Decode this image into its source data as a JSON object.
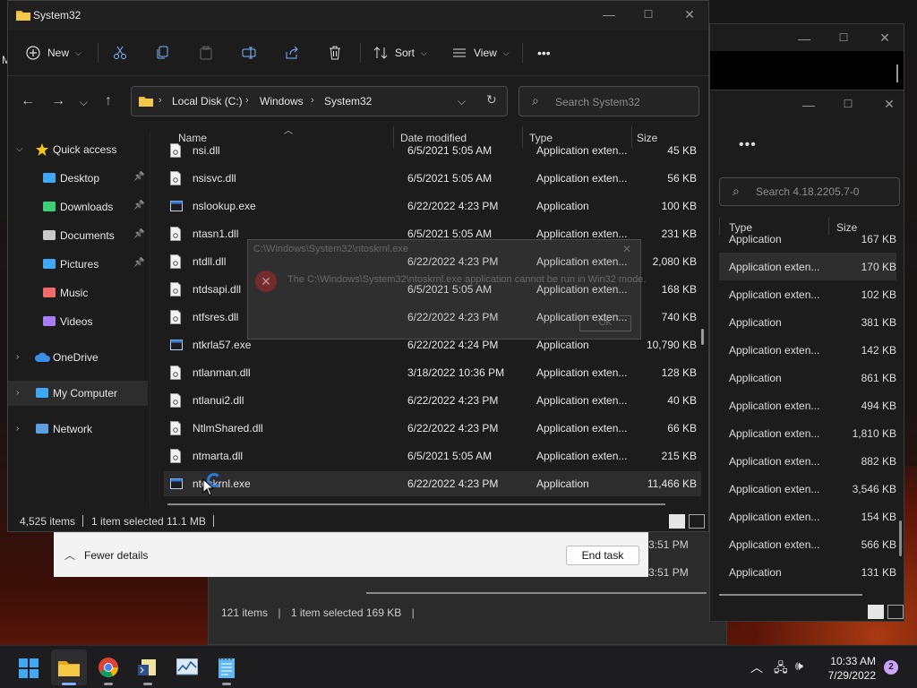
{
  "explorer": {
    "title": "System32",
    "toolbar": {
      "new_label": "New",
      "sort_label": "Sort",
      "view_label": "View",
      "more_label": "•••"
    },
    "address": {
      "crumbs": [
        "Local Disk (C:)",
        "Windows",
        "System32"
      ]
    },
    "search_placeholder": "Search System32",
    "nav": [
      {
        "label": "Quick access",
        "icon": "star-icon",
        "expanded": true
      },
      {
        "label": "Desktop",
        "icon": "desktop-icon",
        "pinned": true
      },
      {
        "label": "Downloads",
        "icon": "download-icon",
        "pinned": true
      },
      {
        "label": "Documents",
        "icon": "document-icon",
        "pinned": true
      },
      {
        "label": "Pictures",
        "icon": "picture-icon",
        "pinned": true
      },
      {
        "label": "Music",
        "icon": "music-icon"
      },
      {
        "label": "Videos",
        "icon": "video-icon"
      },
      {
        "label": "OneDrive",
        "icon": "cloud-icon"
      },
      {
        "label": "My Computer",
        "icon": "computer-icon",
        "selected": true
      },
      {
        "label": "Network",
        "icon": "network-icon"
      }
    ],
    "columns": {
      "name": "Name",
      "date": "Date modified",
      "type": "Type",
      "size": "Size"
    },
    "files": [
      {
        "name": "nsi.dll",
        "date": "6/5/2021 5:05 AM",
        "type": "Application exten...",
        "size": "45 KB",
        "icon": "dll-icon"
      },
      {
        "name": "nsisvc.dll",
        "date": "6/5/2021 5:05 AM",
        "type": "Application exten...",
        "size": "56 KB",
        "icon": "dll-icon"
      },
      {
        "name": "nslookup.exe",
        "date": "6/22/2022 4:23 PM",
        "type": "Application",
        "size": "100 KB",
        "icon": "exe-icon"
      },
      {
        "name": "ntasn1.dll",
        "date": "6/5/2021 5:05 AM",
        "type": "Application exten...",
        "size": "231 KB",
        "icon": "dll-icon"
      },
      {
        "name": "ntdll.dll",
        "date": "6/22/2022 4:23 PM",
        "type": "Application exten...",
        "size": "2,080 KB",
        "icon": "dll-icon"
      },
      {
        "name": "ntdsapi.dll",
        "date": "6/5/2021 5:05 AM",
        "type": "Application exten...",
        "size": "168 KB",
        "icon": "dll-icon"
      },
      {
        "name": "ntfsres.dll",
        "date": "6/22/2022 4:23 PM",
        "type": "Application exten...",
        "size": "740 KB",
        "icon": "dll-icon"
      },
      {
        "name": "ntkrla57.exe",
        "date": "6/22/2022 4:24 PM",
        "type": "Application",
        "size": "10,790 KB",
        "icon": "exe-icon"
      },
      {
        "name": "ntlanman.dll",
        "date": "3/18/2022 10:36 PM",
        "type": "Application exten...",
        "size": "128 KB",
        "icon": "dll-icon"
      },
      {
        "name": "ntlanui2.dll",
        "date": "6/22/2022 4:23 PM",
        "type": "Application exten...",
        "size": "40 KB",
        "icon": "dll-icon"
      },
      {
        "name": "NtlmShared.dll",
        "date": "6/22/2022 4:23 PM",
        "type": "Application exten...",
        "size": "66 KB",
        "icon": "dll-icon"
      },
      {
        "name": "ntmarta.dll",
        "date": "6/5/2021 5:05 AM",
        "type": "Application exten...",
        "size": "215 KB",
        "icon": "dll-icon"
      },
      {
        "name": "ntoskrnl.exe",
        "date": "6/22/2022 4:23 PM",
        "type": "Application",
        "size": "11,466 KB",
        "icon": "exe-icon",
        "selected": true
      }
    ],
    "status": {
      "items": "4,525 items",
      "selected": "1 item selected  11.1 MB"
    }
  },
  "error_dialog": {
    "title": "C:\\Windows\\System32\\ntoskrnl.exe",
    "message": "The C:\\Windows\\System32\\ntoskrnl.exe application cannot be run in Win32 mode.",
    "ok": "OK"
  },
  "explorer2": {
    "search_placeholder": "Search 4.18.2205.7-0",
    "columns": {
      "type": "Type",
      "size": "Size"
    },
    "rows": [
      {
        "type": "Application",
        "size": "167 KB"
      },
      {
        "type": "Application exten...",
        "size": "170 KB",
        "selected": true
      },
      {
        "type": "Application exten...",
        "size": "102 KB"
      },
      {
        "type": "Application",
        "size": "381 KB"
      },
      {
        "type": "Application exten...",
        "size": "142 KB"
      },
      {
        "type": "Application",
        "size": "861 KB"
      },
      {
        "type": "Application exten...",
        "size": "494 KB"
      },
      {
        "type": "Application exten...",
        "size": "1,810 KB"
      },
      {
        "type": "Application exten...",
        "size": "882 KB"
      },
      {
        "type": "Application exten...",
        "size": "3,546 KB"
      },
      {
        "type": "Application exten...",
        "size": "154 KB"
      },
      {
        "type": "Application exten...",
        "size": "566 KB"
      },
      {
        "type": "Application",
        "size": "131 KB"
      }
    ],
    "status": {
      "items": "121 items",
      "selected": "1 item selected  169 KB"
    }
  },
  "taskmgr": {
    "fewer_details": "Fewer details",
    "end_task": "End task",
    "times": [
      "3:51 PM",
      "3:51 PM"
    ]
  },
  "background": {
    "left_letter": "M"
  },
  "taskbar": {
    "apps": [
      "start-icon",
      "file-explorer-icon",
      "chrome-icon",
      "scripting-tool-icon",
      "performance-monitor-icon",
      "notepad-icon"
    ],
    "time": "10:33 AM",
    "date": "7/29/2022",
    "notifications": "2"
  }
}
